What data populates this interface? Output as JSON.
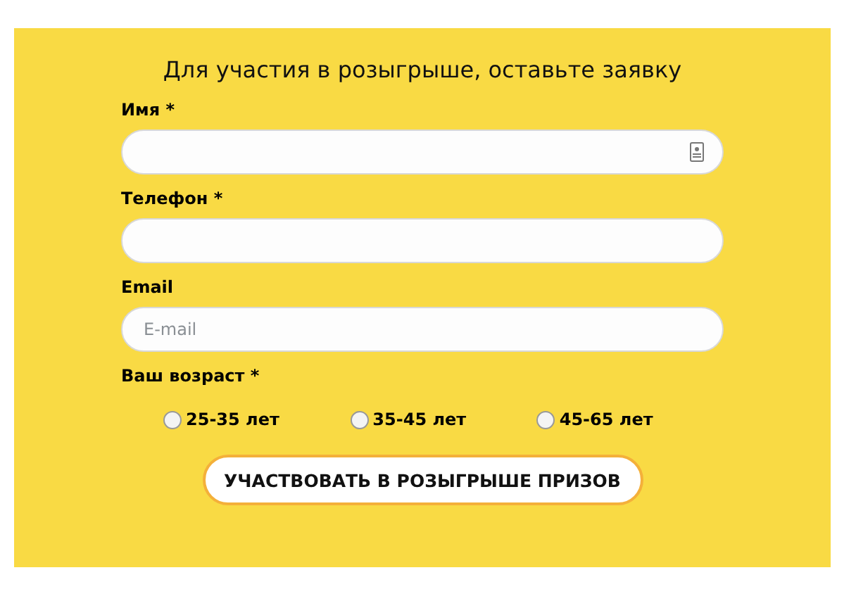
{
  "form": {
    "title": "Для участия в розыгрыше, оставьте заявку",
    "fields": [
      {
        "label": "Имя *",
        "kind": "contact"
      },
      {
        "label": "Телефон *",
        "kind": "plain"
      },
      {
        "label": "Email",
        "kind": "plain",
        "placeholder": "E-mail"
      }
    ],
    "age": {
      "label": "Ваш возраст *",
      "options": [
        {
          "label": "25-35 лет",
          "selected": false
        },
        {
          "label": "35-45 лет",
          "selected": false
        },
        {
          "label": "45-65 лет",
          "selected": false
        }
      ]
    },
    "submit": "УЧАСТВОВАТЬ В РОЗЫГРЫШЕ ПРИЗОВ"
  }
}
